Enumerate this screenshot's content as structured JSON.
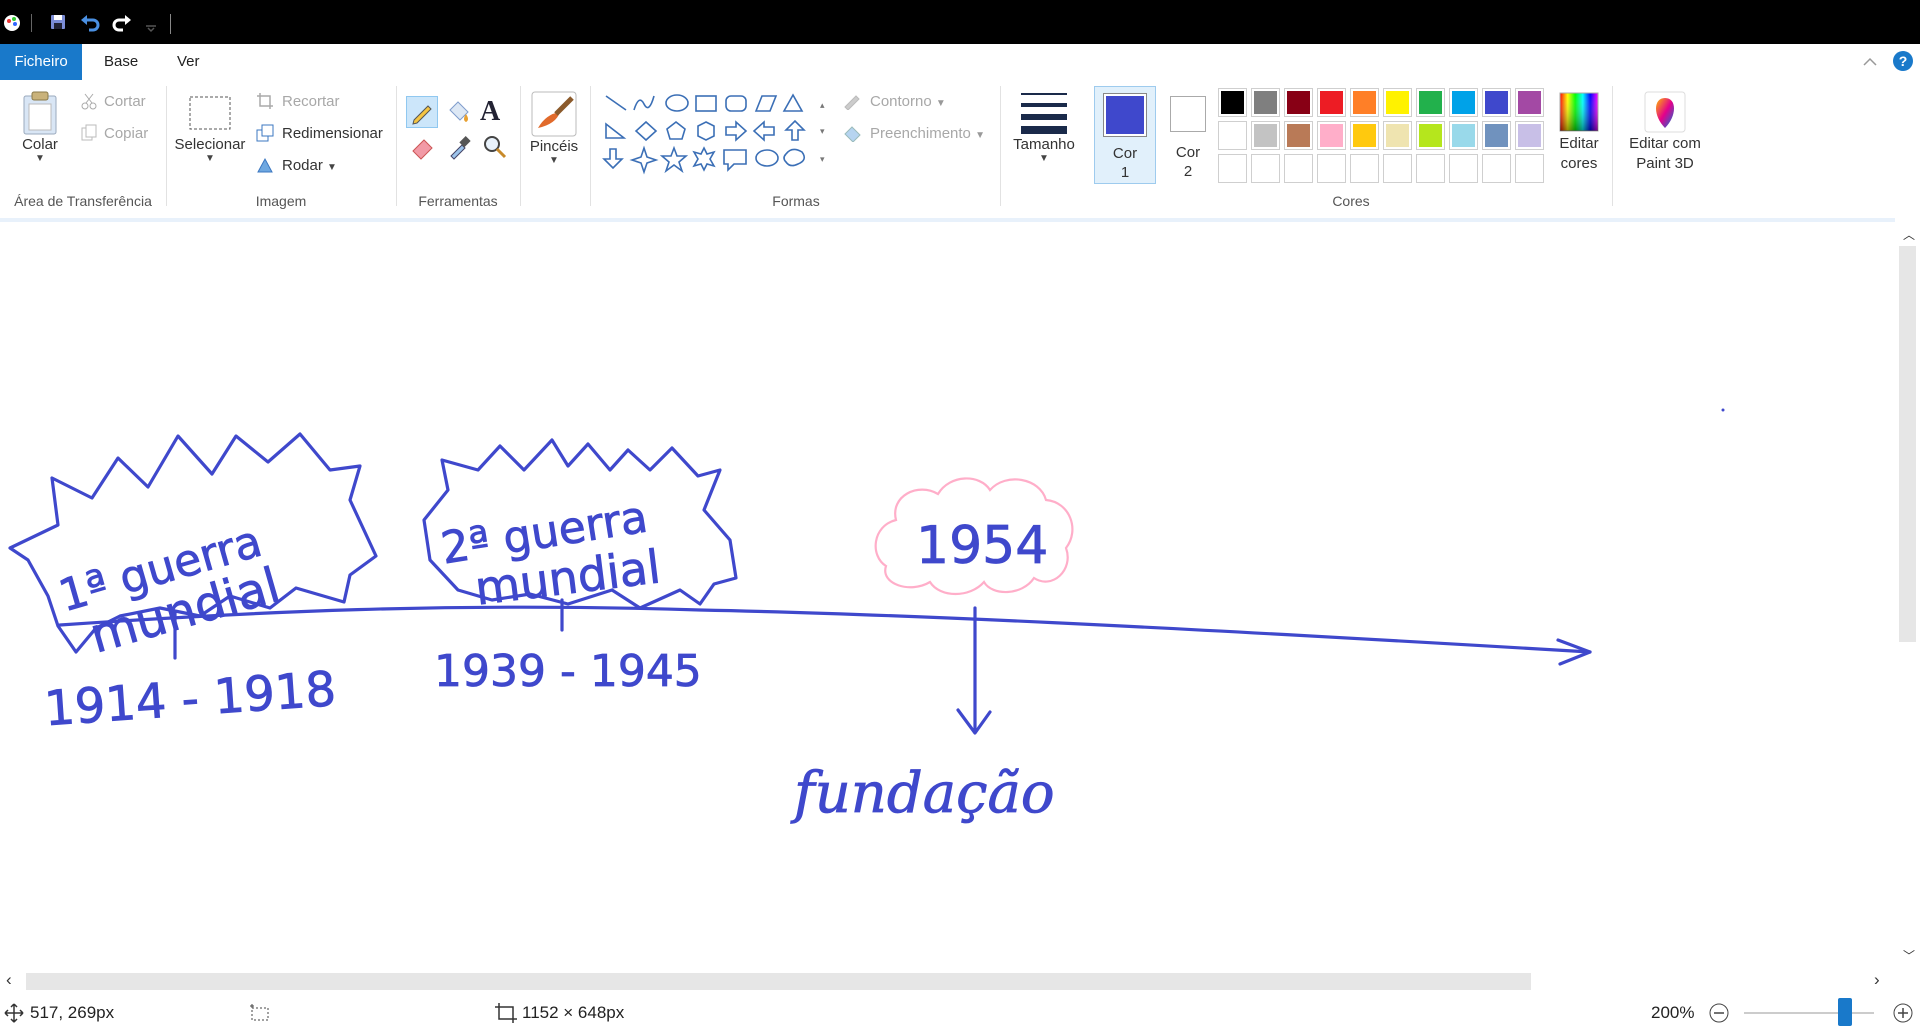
{
  "ribbon_tabs": [
    "Ficheiro",
    "Base",
    "Ver"
  ],
  "clipboard": {
    "paste": "Colar",
    "cut": "Cortar",
    "copy": "Copiar",
    "group": "Área de Transferência"
  },
  "image": {
    "select": "Selecionar",
    "crop": "Recortar",
    "resize": "Redimensionar",
    "rotate": "Rodar",
    "group": "Imagem"
  },
  "tools": {
    "group": "Ferramentas"
  },
  "brushes": {
    "label": "Pincéis"
  },
  "shapes": {
    "outline": "Contorno",
    "fill": "Preenchimento",
    "group": "Formas"
  },
  "size": {
    "label": "Tamanho"
  },
  "colors": {
    "color1_label": "Cor",
    "color1_num": "1",
    "color2_label": "Cor",
    "color2_num": "2",
    "edit_line1": "Editar",
    "edit_line2": "cores",
    "paint3d_line1": "Editar com",
    "paint3d_line2": "Paint 3D",
    "group": "Cores",
    "color1_value": "#3f48cc",
    "color2_value": "#ffffff",
    "palette_row1": [
      "#000000",
      "#7f7f7f",
      "#880015",
      "#ed1c24",
      "#ff7f27",
      "#fff200",
      "#22b14c",
      "#00a2e8",
      "#3f48cc",
      "#a349a4"
    ],
    "palette_row2": [
      "#ffffff",
      "#c3c3c3",
      "#b97a57",
      "#ffaec9",
      "#ffc90e",
      "#efe4b0",
      "#b5e61d",
      "#99d9ea",
      "#7092be",
      "#c8bfe7"
    ]
  },
  "drawing": {
    "stroke_color": "#3f48cc",
    "cloud_color": "#ffaec9",
    "text_ww1_line1": "1ª guerra",
    "text_ww1_line2": "mundial",
    "text_ww2_line1": "2ª guerra",
    "text_ww2_line2": "mundial",
    "text_year": "1954",
    "text_dates1": "1914 - 1918",
    "text_dates2": "1939 - 1945",
    "text_founding": "fundação"
  },
  "status": {
    "cursor_pos": "517, 269px",
    "canvas_size": "1152 × 648px",
    "zoom": "200%",
    "zoom_fraction": 0.78
  }
}
